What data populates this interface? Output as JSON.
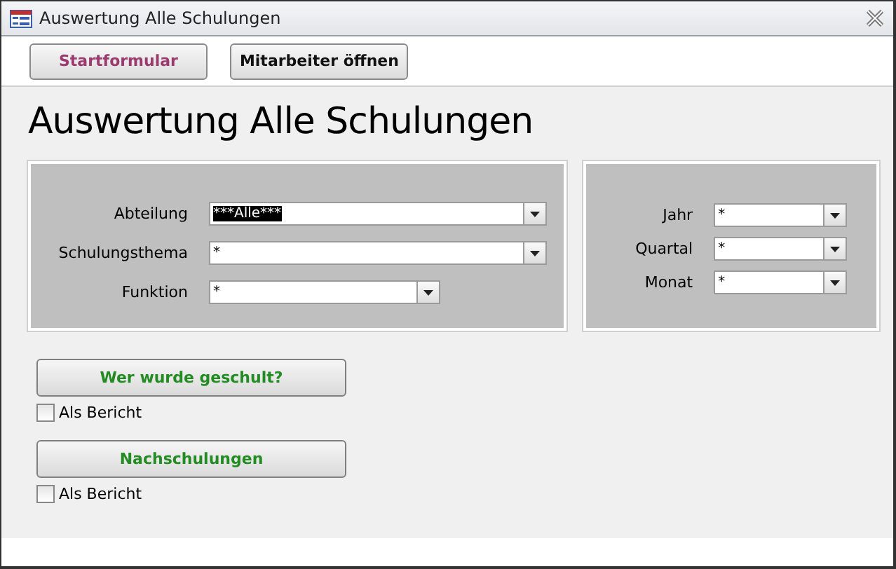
{
  "window": {
    "title": "Auswertung Alle Schulungen"
  },
  "header_buttons": [
    {
      "label": "Startformular",
      "color": "#9b3a6e"
    },
    {
      "label": "Mitarbeiter öffnen",
      "color": "#111111"
    }
  ],
  "heading": "Auswertung Alle Schulungen",
  "filters_left": [
    {
      "label": "Abteilung",
      "value": "***Alle***",
      "selected": true,
      "kind": "wide"
    },
    {
      "label": "Schulungsthema",
      "value": "*",
      "selected": false,
      "kind": "wide"
    },
    {
      "label": "Funktion",
      "value": "*",
      "selected": false,
      "kind": "narrow"
    }
  ],
  "filters_right": [
    {
      "label": "Jahr",
      "value": "*",
      "selected": false
    },
    {
      "label": "Quartal",
      "value": "*",
      "selected": false
    },
    {
      "label": "Monat",
      "value": "*",
      "selected": false
    }
  ],
  "actions": [
    {
      "label": "Wer wurde geschult?",
      "color": "#228b22",
      "option": {
        "label": "Als Bericht",
        "checked": false
      }
    },
    {
      "label": "Nachschulungen",
      "color": "#228b22",
      "option": {
        "label": "Als Bericht",
        "checked": false
      }
    }
  ]
}
